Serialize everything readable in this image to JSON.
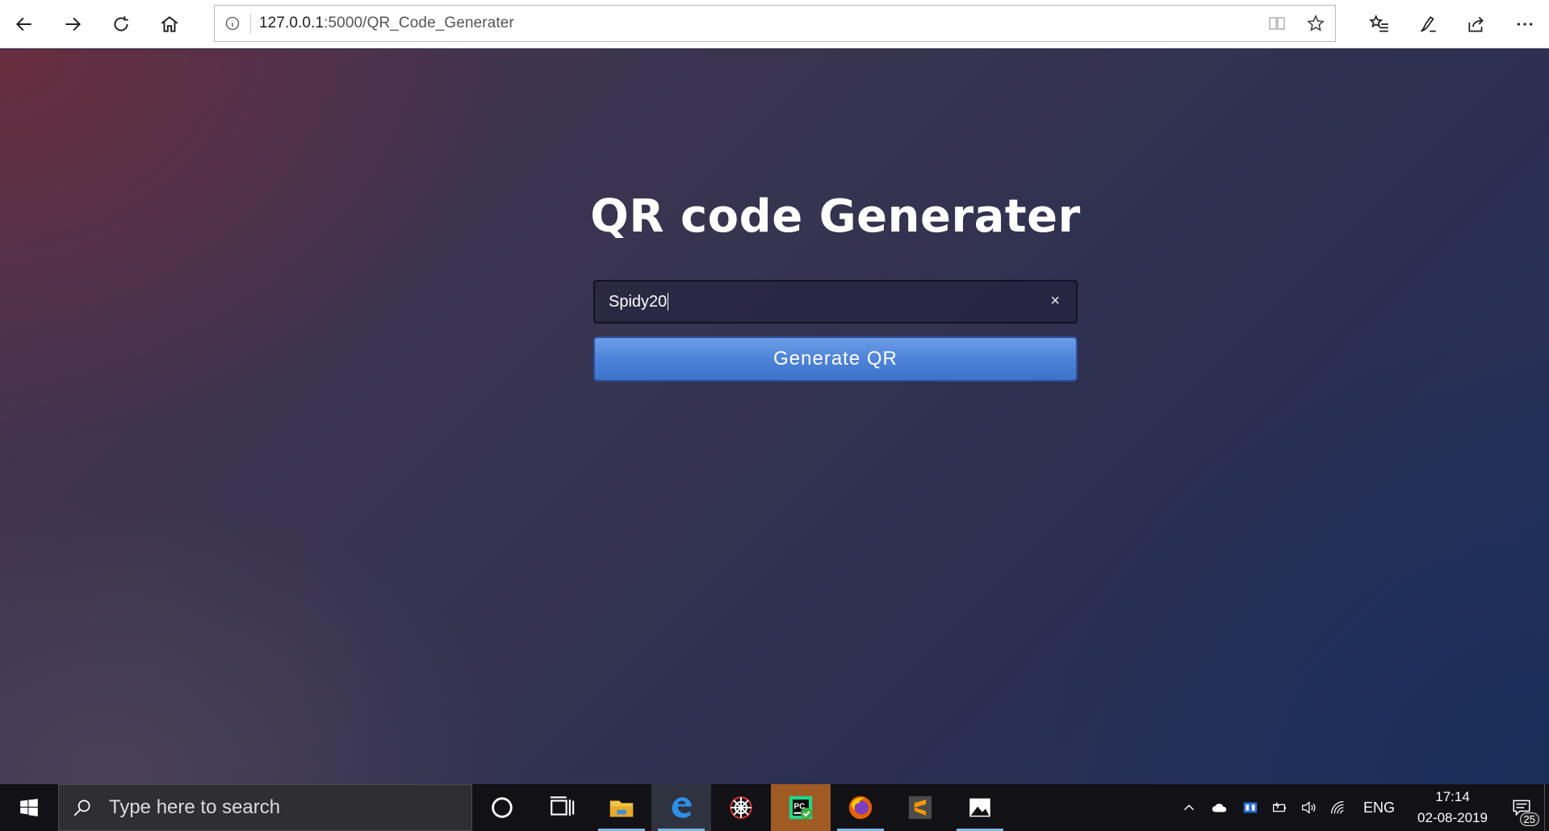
{
  "browser": {
    "url_host": "127.0.0.1",
    "url_path": ":5000/QR_Code_Generater",
    "nav_icons": [
      "back-arrow-icon",
      "forward-arrow-icon",
      "refresh-icon",
      "home-icon"
    ],
    "address_icons": [
      "reading-view-icon",
      "favorite-star-icon"
    ],
    "tool_icons": [
      "favorites-list-icon",
      "pen-icon",
      "share-icon",
      "more-icon"
    ]
  },
  "page": {
    "title": "QR code Generater",
    "input_value": "Spidy20",
    "clear_symbol": "×",
    "button_label": "Generate QR",
    "button_color": "#4e84d9"
  },
  "taskbar": {
    "search_placeholder": "Type here to search",
    "apps": [
      "cortana-icon",
      "task-view-icon",
      "file-explorer-icon",
      "edge-icon",
      "spider-app-icon",
      "pycharm-icon",
      "firefox-icon",
      "sublime-icon",
      "photos-icon"
    ],
    "language": "ENG",
    "time": "17:14",
    "date": "02-08-2019",
    "notification_count": "25"
  }
}
